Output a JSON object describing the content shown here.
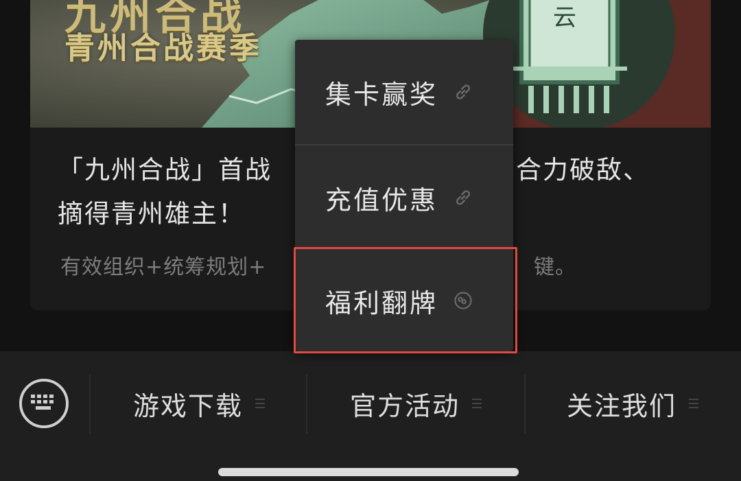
{
  "card": {
    "banner_title_top": "九州合战",
    "banner_subtitle": "青州合战赛季",
    "banner_seal_char": "云",
    "headline": "「九州合战」首战 … 合力破敌、摘得青州雄主！",
    "headline_line1_left": "「九州合战」首战",
    "headline_line1_right": "合力破敌、",
    "headline_line2": "摘得青州雄主！",
    "summary_left": "有效组织+统筹规划+",
    "summary_right": "键。"
  },
  "popup": {
    "items": [
      {
        "label": "集卡赢奖",
        "icon": "link-icon"
      },
      {
        "label": "充值优惠",
        "icon": "link-icon"
      },
      {
        "label": "福利翻牌",
        "icon": "mini-program-icon"
      }
    ]
  },
  "menubar": {
    "keyboard_icon": "keyboard-icon",
    "items": [
      {
        "label": "游戏下载"
      },
      {
        "label": "官方活动"
      },
      {
        "label": "关注我们"
      }
    ]
  },
  "colors": {
    "background": "#121212",
    "highlight": "#e04a3f",
    "banner_green": "#7fae94",
    "banner_gold": "#d8c88a"
  }
}
